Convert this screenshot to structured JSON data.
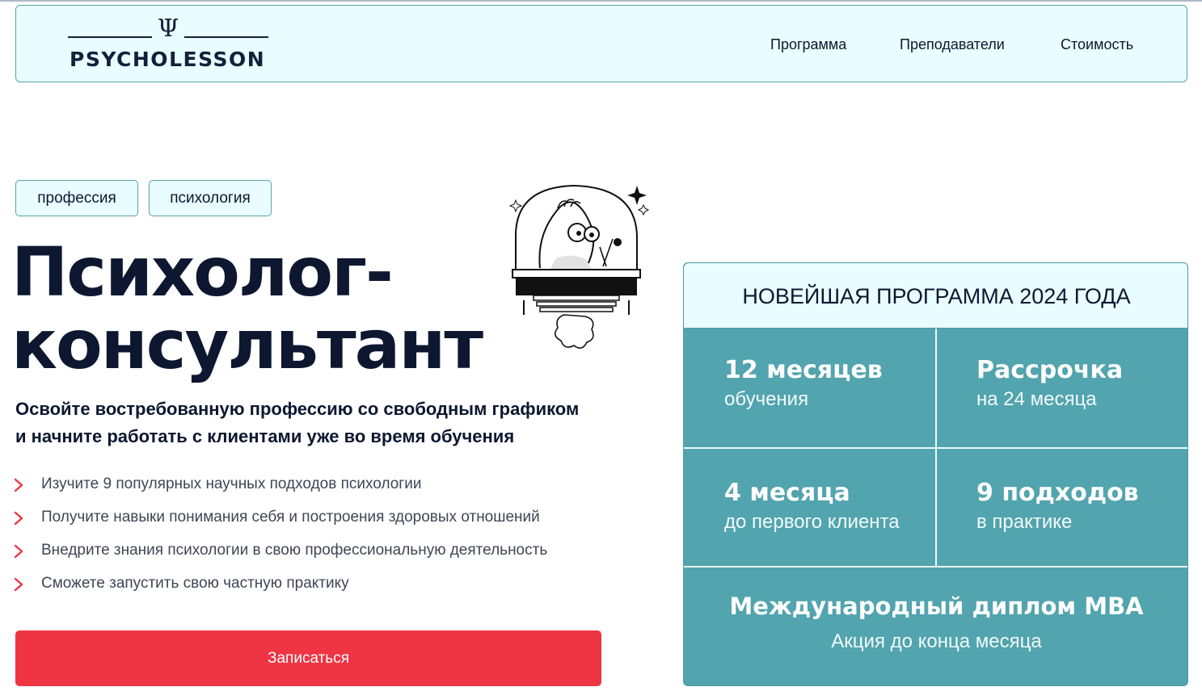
{
  "header": {
    "logo_text": "PSYCHOLESSON",
    "logo_symbol": "Ψ",
    "nav": [
      "Программа",
      "Преподаватели",
      "Стоимость"
    ]
  },
  "tags": [
    "профессия",
    "психология"
  ],
  "hero": {
    "title_line1": "Психолог-",
    "title_line2": "консультант",
    "subtitle_line1": "Освойте востребованную профессию со свободным графиком",
    "subtitle_line2": "и начните работать с клиентами уже во время обучения"
  },
  "bullets": [
    "Изучите 9 популярных научных подходов психологии",
    "Получите навыки понимания себя и построения здоровых отношений",
    "Внедрите знания психологии в свою профессиональную деятельность",
    "Сможете запустить свою частную практику"
  ],
  "cta_label": "Записаться",
  "card": {
    "heading": "НОВЕЙШАЯ ПРОГРАММА 2024 ГОДА",
    "cells": [
      {
        "big": "12 месяцев",
        "small": "обучения"
      },
      {
        "big": "Рассрочка",
        "small": "на 24 месяца"
      },
      {
        "big": "4 месяца",
        "small": "до первого клиента"
      },
      {
        "big": "9 подходов",
        "small": "в практике"
      }
    ],
    "bottom_big": "Международный диплом MBA",
    "bottom_small": "Акция до конца месяца"
  },
  "colors": {
    "accent_red": "#ef3444",
    "teal": "#52a4ae",
    "light_cyan": "#e9fcff",
    "text_dark": "#0d1730"
  },
  "icons": [
    "chevron-right-icon",
    "psi-icon",
    "brain-jar-illustration"
  ]
}
